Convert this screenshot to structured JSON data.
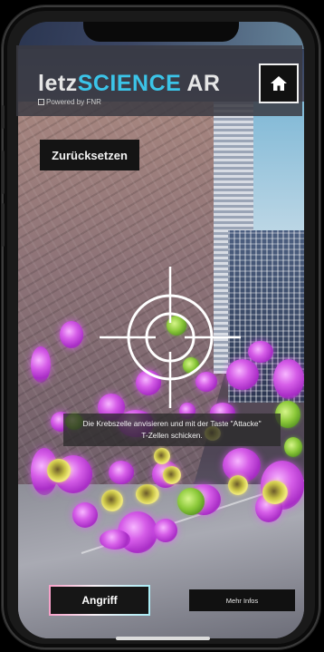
{
  "app": {
    "logo_part1": "letz",
    "logo_part2": "SCIENCE",
    "logo_part3": "AR",
    "powered_by": "Powered by FNR"
  },
  "header": {
    "home_icon": "home-icon"
  },
  "buttons": {
    "reset_label": "Zurücksetzen",
    "attack_label": "Angriff",
    "more_info_label": "Mehr Infos"
  },
  "instruction": {
    "line1": "Die Krebszelle anvisieren und mit der Taste \"Attacke\"",
    "line2": "T-Zellen schicken."
  },
  "colors": {
    "accent": "#3bc4e8",
    "cancer_cell": "#d65ee8",
    "t_cell": "#8cc93a",
    "helper_cell": "#f1ea7a"
  }
}
